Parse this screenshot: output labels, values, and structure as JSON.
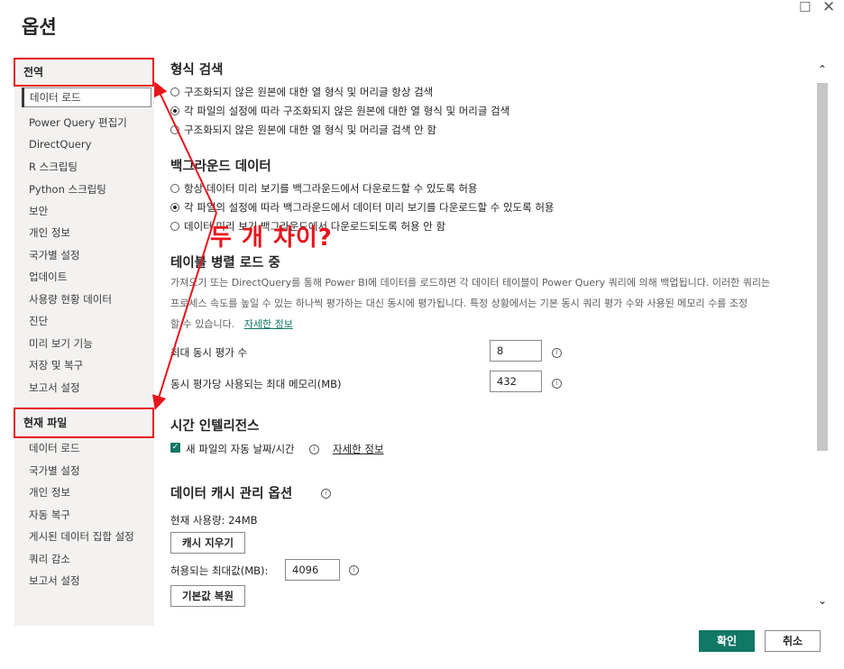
{
  "dialog": {
    "title": "옵션"
  },
  "sidebar": {
    "global_header": "전역",
    "global_items": [
      "데이터 로드",
      "Power Query 편집기",
      "DirectQuery",
      "R 스크립팅",
      "Python 스크립팅",
      "보안",
      "개인 정보",
      "국가별 설정",
      "업데이트",
      "사용량 현황 데이터",
      "진단",
      "미리 보기 기능",
      "저장 및 복구",
      "보고서 설정"
    ],
    "current_header": "현재 파일",
    "current_items": [
      "데이터 로드",
      "국가별 설정",
      "개인 정보",
      "자동 복구",
      "게시된 데이터 집합 설정",
      "쿼리 감소",
      "보고서 설정"
    ]
  },
  "type_detection": {
    "heading": "형식 검색",
    "options": [
      "구조화되지 않은 원본에 대한 열 형식 및 머리글 항상 검색",
      "각 파일의 설정에 따라 구조화되지 않은 원본에 대한 열 형식 및 머리글 검색",
      "구조화되지 않은 원본에 대한 열 형식 및 머리글 검색 안 함"
    ],
    "selected": 1
  },
  "background_data": {
    "heading": "백그라운드 데이터",
    "options": [
      "항상 데이터 미리 보기를 백그라운드에서 다운로드할 수 있도록 허용",
      "각 파일의 설정에 따라 백그라운드에서 데이터 미리 보기를 다운로드할 수 있도록 허용",
      "데이터 미리 보기 백그라운드에서 다운로드되도록 허용 안 함"
    ],
    "selected": 1
  },
  "parallel_loading": {
    "heading": "테이블 병렬 로드 중",
    "description_lines": [
      "가져오기 또는 DirectQuery를 통해 Power BI에 데이터를 로드하면 각 데이터 테이블이 Power Query 쿼리에 의해 백업됩니다. 이러한 쿼리는",
      "프로세스 속도를 높일 수 있는 하나씩 평가하는 대신 동시에 평가됩니다. 특정 상황에서는 기본 동시 쿼리 평가 수와 사용된 메모리 수를 조정",
      "할 수 있습니다."
    ],
    "learn_more": "자세한 정보",
    "max_concurrent_label": "최대 동시 평가 수",
    "max_concurrent_value": "8",
    "max_memory_label": "동시 평가당 사용되는 최대 메모리(MB)",
    "max_memory_value": "432",
    "info_glyph": "i"
  },
  "time_intelligence": {
    "heading": "시간 인텔리전스",
    "auto_date_label": "새 파일의 자동 날짜/시간",
    "auto_date_checked": true,
    "check_glyph": "✓",
    "learn_more": "자세한 정보"
  },
  "data_cache": {
    "heading": "데이터 캐시 관리 옵션",
    "current_usage": "현재 사용량: 24MB",
    "clear_cache_label": "캐시 지우기",
    "max_allowed_label": "허용되는 최대값(MB):",
    "max_allowed_value": "4096",
    "restore_defaults_label": "기본값 복원"
  },
  "scrollbar": {
    "up_glyph": "⌃",
    "down_glyph": "⌄"
  },
  "window": {
    "max_glyph": "☐",
    "close_glyph": "✕"
  },
  "footer": {
    "ok_label": "확인",
    "cancel_label": "취소"
  },
  "annotation": {
    "text": "두 개 차이?",
    "color": "#e8141b"
  },
  "colors": {
    "accent": "#117865",
    "sidebar_bg": "#f3f2f1"
  }
}
